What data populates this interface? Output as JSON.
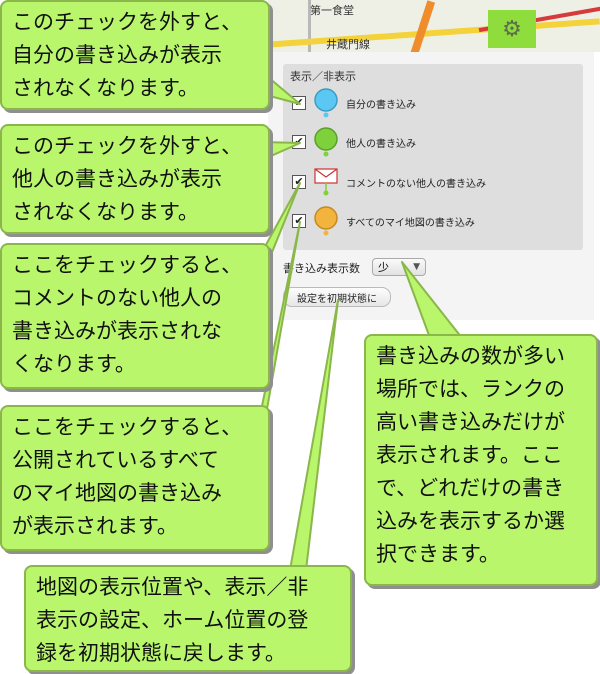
{
  "map": {
    "labels": [
      "第一食堂",
      "井蔵門線"
    ]
  },
  "gear_icon": "gear-icon",
  "panel": {
    "section_title": "表示／非表示",
    "items": [
      {
        "label": "自分の書き込み",
        "checked": "✔",
        "icon": "blue-bubble-icon",
        "color": "#5ac8f2"
      },
      {
        "label": "他人の書き込み",
        "checked": "✔",
        "icon": "green-bubble-icon",
        "color": "#7fd13b"
      },
      {
        "label": "コメントのない他人の書き込み",
        "checked": "✔",
        "icon": "envelope-pin-icon",
        "color": "#d84a4a"
      },
      {
        "label": "すべてのマイ地図の書き込み",
        "checked": "✔",
        "icon": "orange-bubble-icon",
        "color": "#f2b43c"
      }
    ],
    "count_label": "書き込み表示数",
    "count_value": "少",
    "reset_label": "設定を初期状態に"
  },
  "callouts": [
    {
      "text": "このチェックを外すと、\n自分の書き込みが表示\nされなくなります。"
    },
    {
      "text": "このチェックを外すと、\n他人の書き込みが表示\nされなくなります。"
    },
    {
      "text": "ここをチェックすると、\nコメントのない他人の\n書き込みが表示されな\nくなります。"
    },
    {
      "text": "ここをチェックすると、\n公開されているすべて\nのマイ地図の書き込み\nが表示されます。"
    },
    {
      "text": "地図の表示位置や、表示／非\n表示の設定、ホーム位置の登\n録を初期状態に戻します。"
    },
    {
      "text": "書き込みの数が多い\n場所では、ランクの\n高い書き込みだけが\n表示されます。ここ\nで、どれだけの書き\n込みを表示するか選\n択できます。"
    }
  ]
}
